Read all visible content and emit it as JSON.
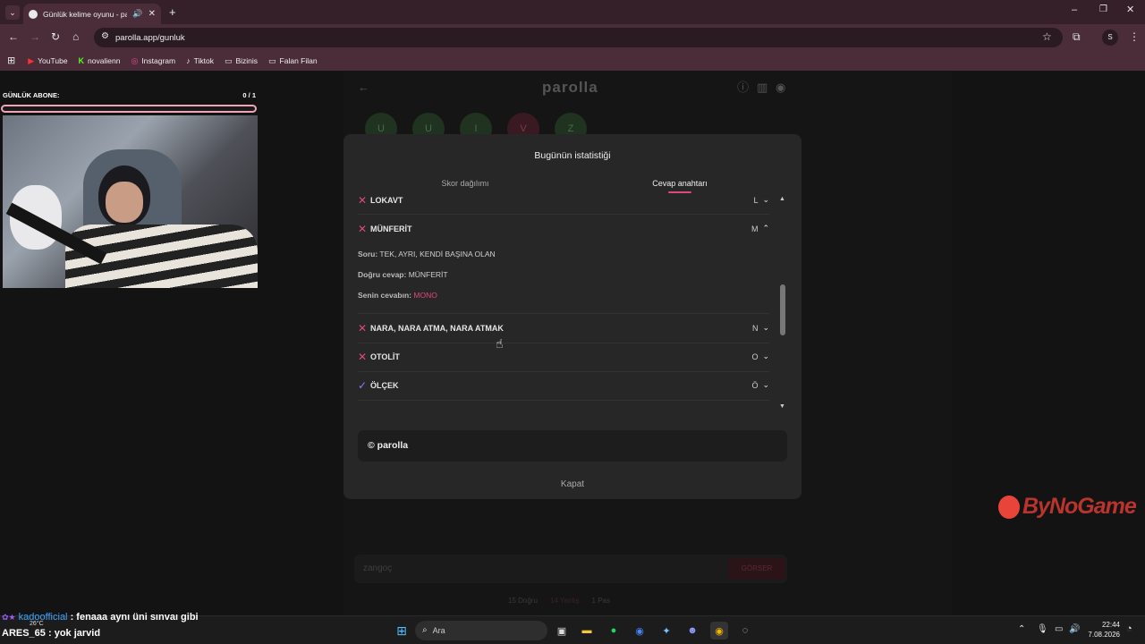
{
  "browser": {
    "tab_title": "Günlük kelime oyunu - parc",
    "url": "parolla.app/gunluk",
    "profile_initial": "S",
    "bookmarks": [
      {
        "label": "YouTube"
      },
      {
        "label": "novalienn"
      },
      {
        "label": "Instagram"
      },
      {
        "label": "Tiktok"
      },
      {
        "label": "Bizinis"
      },
      {
        "label": "Falan Filan"
      }
    ]
  },
  "overlay": {
    "sub_label": "GÜNLÜK ABONE:",
    "sub_count": "0 / 1",
    "watermark": "ByNoGame",
    "chat": [
      {
        "user": "kadoofficial",
        "text": " : fenaaa aynı üni sınvaı gibi"
      },
      {
        "user": "ARES_65",
        "text": " : yok jarvid"
      }
    ]
  },
  "app": {
    "logo": "parolla",
    "letters": [
      "U",
      "U",
      "I",
      "V",
      "Z"
    ],
    "input_placeholder": "zangoç",
    "submit_label": "GÖRSER",
    "stats_line": [
      "15 Doğru",
      "14 Yanlış",
      "1 Pas"
    ]
  },
  "modal": {
    "title": "Bugünün istatistiği",
    "tabs": [
      "Skor dağılımı",
      "Cevap anahtarı"
    ],
    "active_tab": 1,
    "rows": [
      {
        "status": "wrong",
        "word": "LOKAVT",
        "letter": "L",
        "expanded": false
      },
      {
        "status": "wrong",
        "word": "MÜNFERİT",
        "letter": "M",
        "expanded": true
      },
      {
        "status": "wrong",
        "word": "NARA, NARA ATMA, NARA ATMAK",
        "letter": "N",
        "expanded": false
      },
      {
        "status": "wrong",
        "word": "OTOLİT",
        "letter": "O",
        "expanded": false
      },
      {
        "status": "correct",
        "word": "ÖLÇEK",
        "letter": "Ö",
        "expanded": false
      }
    ],
    "detail": {
      "q_label": "Soru:",
      "q_text": "TEK, AYRI, KENDİ BAŞINA OLAN",
      "ans_label": "Doğru cevap:",
      "ans_text": "MÜNFERİT",
      "yours_label": "Senin cevabın:",
      "yours_text": "MONO"
    },
    "footer_brand": "© parolla",
    "close_label": "Kapat"
  },
  "taskbar": {
    "weather_temp": "26°C",
    "search_label": "Ara",
    "time": "22:44",
    "date": "7.08.2026"
  },
  "colors": {
    "accent": "#e0487a",
    "wrong": "#e0487a",
    "correct": "#8a7dff",
    "modal_bg": "#272727",
    "chrome": "#4a2d39"
  }
}
